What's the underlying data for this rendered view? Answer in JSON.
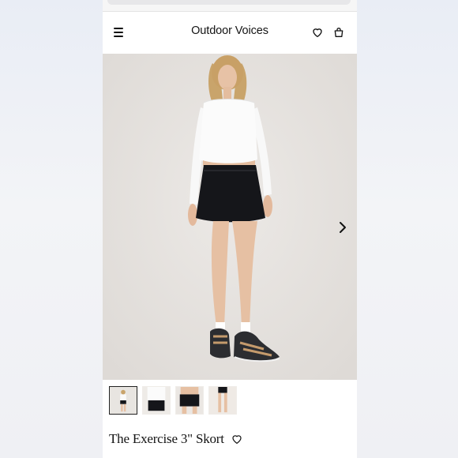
{
  "header": {
    "brand": "Outdoor Voices"
  },
  "product": {
    "title": "The Exercise 3\" Skort"
  },
  "gallery": {
    "thumbnail_count": 4,
    "selected_index": 0
  },
  "icons": {
    "menu": "menu-icon",
    "wishlist": "heart-icon",
    "cart": "shopping-bag-icon",
    "next": "chevron-right-icon"
  }
}
